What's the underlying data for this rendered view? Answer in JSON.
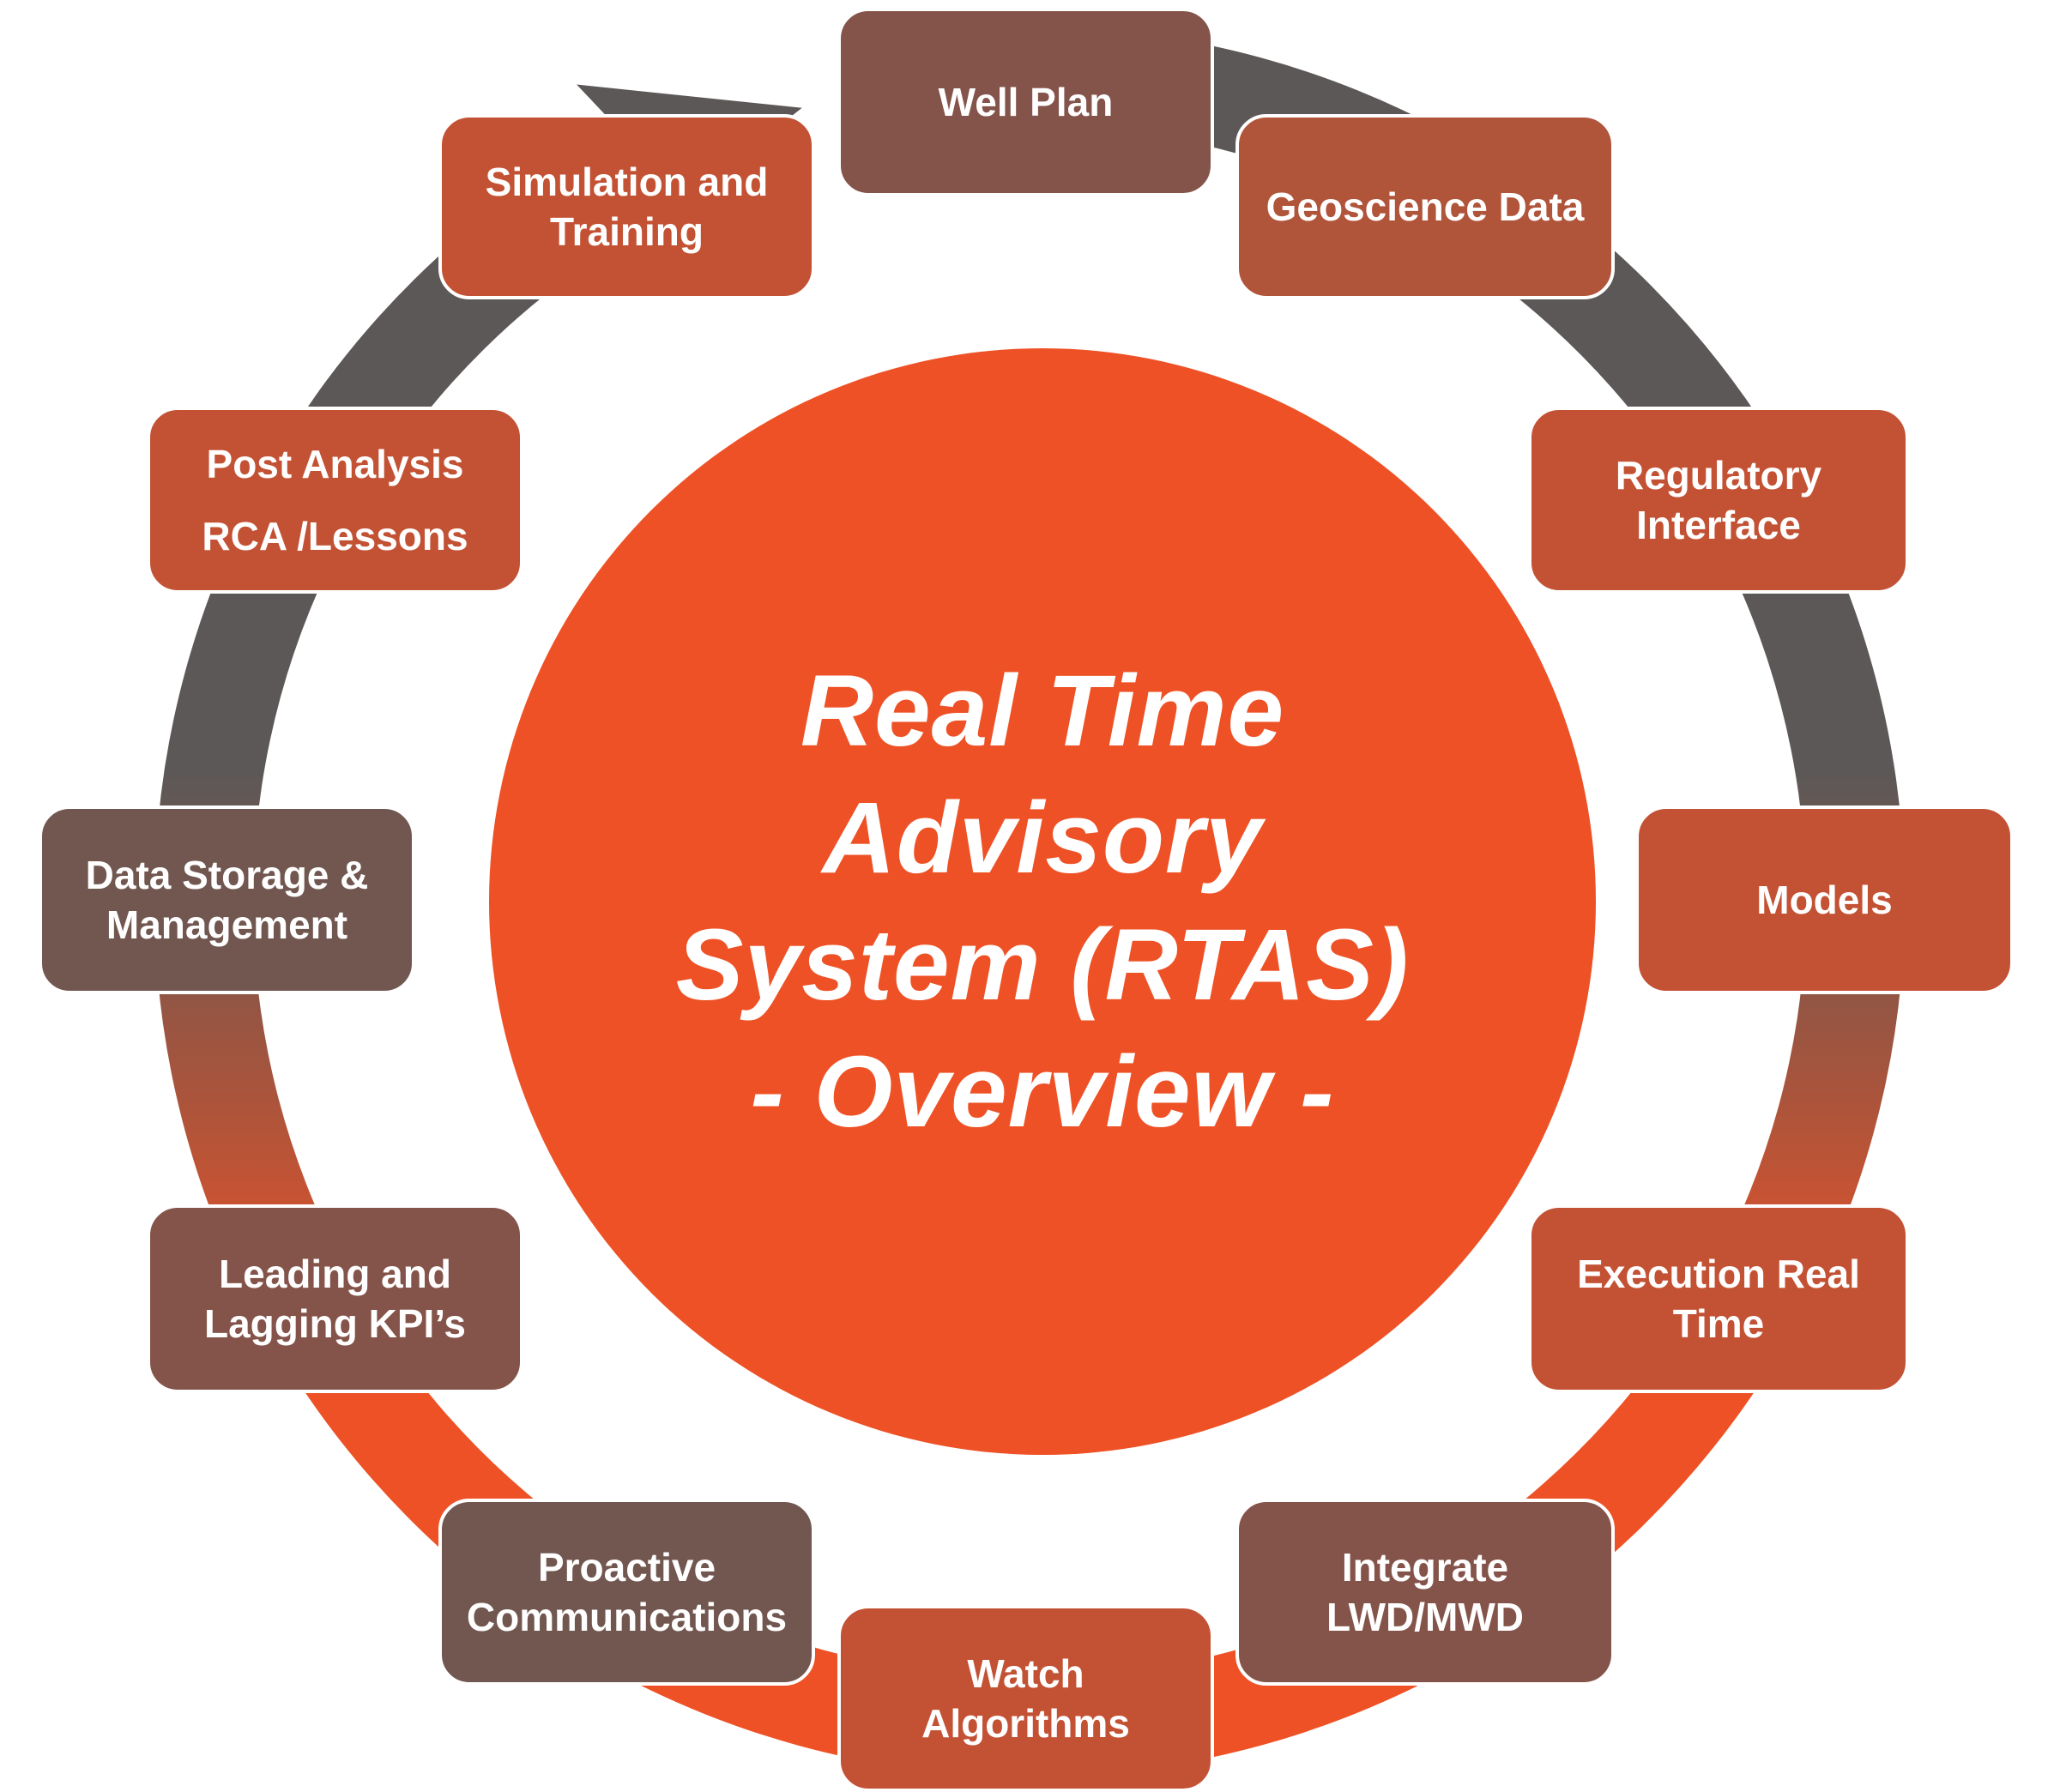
{
  "diagram": {
    "title_lines": [
      "Real Time",
      "Advisory",
      "System (RTAS)",
      "- Overview -"
    ],
    "colors": {
      "center_circle": "#EE5125",
      "ring_dark": "#5C5857",
      "ring_orange": "#EE5125",
      "node_orange": "#C35234",
      "node_rust": "#B0543A",
      "node_brown": "#84544A",
      "node_dark_brown": "#715750",
      "text": "#FFFFFF"
    },
    "flow_direction": "clockwise",
    "nodes": [
      {
        "id": "well-plan",
        "lines": [
          "Well Plan"
        ],
        "color": "#84544A"
      },
      {
        "id": "geoscience-data",
        "lines": [
          "Geoscience Data"
        ],
        "color": "#B0543A"
      },
      {
        "id": "regulatory-interface",
        "lines": [
          "Regulatory",
          "Interface"
        ],
        "color": "#C35234"
      },
      {
        "id": "models",
        "lines": [
          "Models"
        ],
        "color": "#C35234"
      },
      {
        "id": "execution-real-time",
        "lines": [
          "Execution Real",
          "Time"
        ],
        "color": "#C35234"
      },
      {
        "id": "integrate-lwd-mwd",
        "lines": [
          "Integrate",
          "LWD/MWD"
        ],
        "color": "#84544A"
      },
      {
        "id": "watch-algorithms",
        "lines": [
          "Watch",
          "Algorithms"
        ],
        "color": "#C35234"
      },
      {
        "id": "proactive-communications",
        "lines": [
          "Proactive",
          "Communications"
        ],
        "color": "#715750"
      },
      {
        "id": "leading-lagging-kpis",
        "lines": [
          "Leading and",
          "Lagging KPI’s"
        ],
        "color": "#84544A"
      },
      {
        "id": "data-storage-management",
        "lines": [
          "Data Storage &",
          "Management"
        ],
        "color": "#715750"
      },
      {
        "id": "post-analysis",
        "lines": [
          "Post Analysis",
          "RCA /Lessons"
        ],
        "color": "#C35234"
      },
      {
        "id": "simulation-training",
        "lines": [
          "Simulation and",
          "Training"
        ],
        "color": "#C35234"
      }
    ]
  }
}
